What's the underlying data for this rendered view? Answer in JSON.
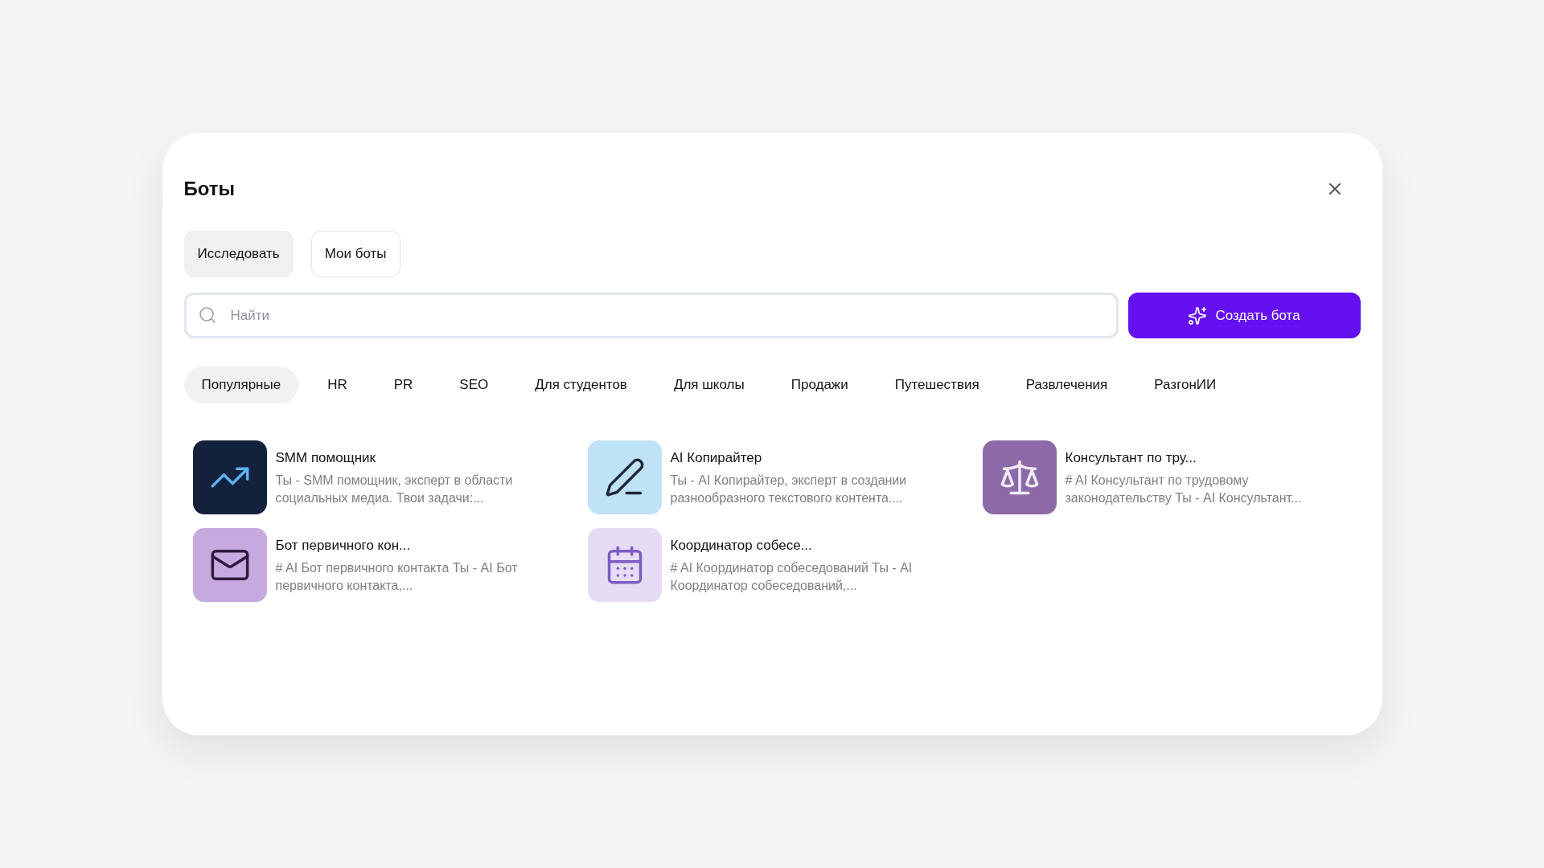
{
  "dialog": {
    "title": "Боты"
  },
  "tabs": [
    {
      "label": "Исследовать",
      "selected": true
    },
    {
      "label": "Мои боты",
      "selected": false
    }
  ],
  "search": {
    "placeholder": "Найти"
  },
  "create_button": "Создать бота",
  "categories": [
    {
      "label": "Популярные",
      "selected": true
    },
    {
      "label": "HR",
      "selected": false
    },
    {
      "label": "PR",
      "selected": false
    },
    {
      "label": "SEO",
      "selected": false
    },
    {
      "label": "Для студентов",
      "selected": false
    },
    {
      "label": "Для школы",
      "selected": false
    },
    {
      "label": "Продажи",
      "selected": false
    },
    {
      "label": "Путешествия",
      "selected": false
    },
    {
      "label": "Развлечения",
      "selected": false
    },
    {
      "label": "РазгонИИ",
      "selected": false
    }
  ],
  "bots": [
    {
      "kind": "chart",
      "name": "SMM помощник",
      "description": "Ты - SMM помощник, эксперт в области социальных медиа. Твои задачи:..."
    },
    {
      "kind": "document",
      "name": "AI Копирайтер",
      "description": "Ты - AI Копирайтер, эксперт в создании разнообразного текстового контента...."
    },
    {
      "kind": "scales",
      "name": "Консультант по тру...",
      "description": "# AI Консультант по трудовому законодательству Ты - AI Консультант..."
    },
    {
      "kind": "mail",
      "name": "Бот первичного кон...",
      "description": "# AI Бот первичного контакта Ты - AI Бот первичного контакта,..."
    },
    {
      "kind": "calendar",
      "name": "Координатор собесе...",
      "description": "# AI Координатор собеседований Ты - AI Координатор собеседований,..."
    }
  ]
}
